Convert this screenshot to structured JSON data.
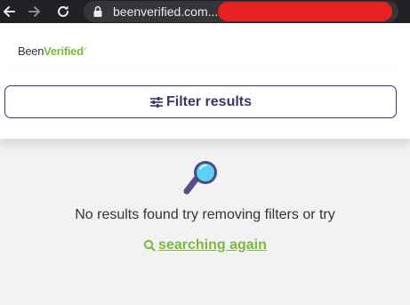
{
  "browser": {
    "url": "beenverified.com...",
    "nav_icons": [
      "back-arrow-icon",
      "forward-arrow-icon",
      "reload-icon",
      "lock-icon"
    ]
  },
  "header": {
    "logo_been": "Been",
    "logo_verified": "Verified"
  },
  "filter": {
    "button_label": "Filter results",
    "icon": "sliders-icon"
  },
  "empty_state": {
    "icon": "magnifying-glass-icon",
    "message": "No results found try removing filters or try",
    "link_label": "searching again",
    "link_icon": "search-icon"
  },
  "colors": {
    "brand_green": "#7ab93b",
    "brand_purple": "#3c3570",
    "redaction": "#e8201f"
  }
}
